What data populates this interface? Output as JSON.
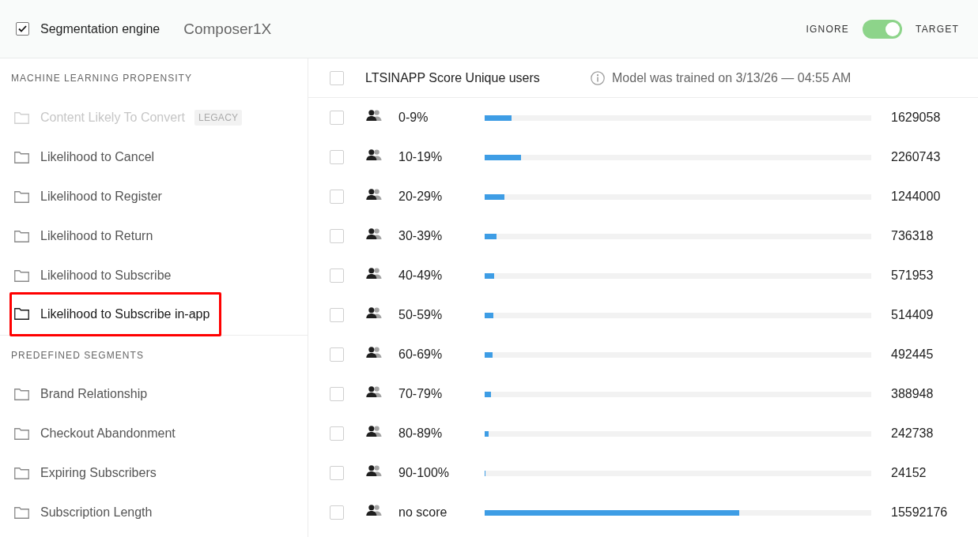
{
  "header": {
    "engine": {
      "label": "Segmentation engine",
      "checked": true
    },
    "name": "Composer1X",
    "toggle": {
      "off_label": "IGNORE",
      "on_label": "TARGET",
      "on": true
    }
  },
  "sidebar": {
    "sections": [
      {
        "title": "MACHINE LEARNING PROPENSITY",
        "items": [
          {
            "label": "Content Likely To Convert",
            "badge": "LEGACY",
            "disabled": true,
            "selected": false
          },
          {
            "label": "Likelihood to Cancel",
            "disabled": false,
            "selected": false
          },
          {
            "label": "Likelihood to Register",
            "disabled": false,
            "selected": false
          },
          {
            "label": "Likelihood to Return",
            "disabled": false,
            "selected": false
          },
          {
            "label": "Likelihood to Subscribe",
            "disabled": false,
            "selected": false
          },
          {
            "label": "Likelihood to Subscribe in-app",
            "disabled": false,
            "selected": true
          }
        ]
      },
      {
        "title": "PREDEFINED SEGMENTS",
        "items": [
          {
            "label": "Brand Relationship",
            "disabled": false,
            "selected": false
          },
          {
            "label": "Checkout Abandonment",
            "disabled": false,
            "selected": false
          },
          {
            "label": "Expiring Subscribers",
            "disabled": false,
            "selected": false
          },
          {
            "label": "Subscription Length",
            "disabled": false,
            "selected": false
          }
        ]
      }
    ]
  },
  "table": {
    "header": {
      "checked": false,
      "title": "LTSINAPP Score Unique users",
      "note": "Model was trained on 3/13/26 — 04:55 AM"
    },
    "rows": [
      {
        "label": "0-9%",
        "checked": false,
        "level": 0.069,
        "count": "1629058"
      },
      {
        "label": "10-19%",
        "checked": false,
        "level": 0.095,
        "count": "2260743"
      },
      {
        "label": "20-29%",
        "checked": false,
        "level": 0.052,
        "count": "1244000"
      },
      {
        "label": "30-39%",
        "checked": false,
        "level": 0.031,
        "count": "736318"
      },
      {
        "label": "40-49%",
        "checked": false,
        "level": 0.024,
        "count": "571953"
      },
      {
        "label": "50-59%",
        "checked": false,
        "level": 0.022,
        "count": "514409"
      },
      {
        "label": "60-69%",
        "checked": false,
        "level": 0.021,
        "count": "492445"
      },
      {
        "label": "70-79%",
        "checked": false,
        "level": 0.016,
        "count": "388948"
      },
      {
        "label": "80-89%",
        "checked": false,
        "level": 0.01,
        "count": "242738"
      },
      {
        "label": "90-100%",
        "checked": false,
        "level": 0.002,
        "count": "24152"
      },
      {
        "label": "no score",
        "checked": false,
        "level": 0.658,
        "count": "15592176"
      }
    ]
  }
}
